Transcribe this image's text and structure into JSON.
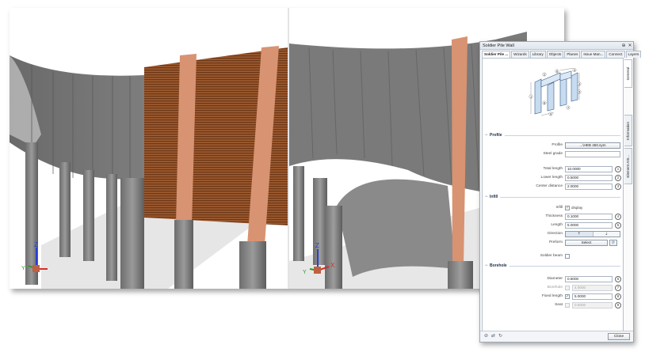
{
  "dialog": {
    "title": "Soldier Pile Wall",
    "pin_glyph": "⊕",
    "close_glyph": "✕",
    "tabs": [
      {
        "label": "Soldier Pile ..."
      },
      {
        "label": "Wizards"
      },
      {
        "label": "Library"
      },
      {
        "label": "Objects"
      },
      {
        "label": "Planes"
      },
      {
        "label": "Issue Man..."
      },
      {
        "label": "Connect"
      },
      {
        "label": "Layers"
      }
    ],
    "side_tabs": [
      {
        "label": "General"
      },
      {
        "label": "Information"
      },
      {
        "label": "Element Attr..."
      }
    ],
    "preview_labels": [
      "1",
      "2",
      "3",
      "4",
      "5",
      "6",
      "7",
      "8",
      "9"
    ],
    "sections": {
      "profile": {
        "title": "Profile",
        "profile_label": "Profile",
        "profile_value": "...\\HEB 450.sym",
        "steel_grade_label": "Steel grade",
        "steel_grade_value": "",
        "total_length_label": "Total length",
        "total_length_value": "10.0000",
        "lower_length_label": "Lower length",
        "lower_length_value": "0.5000",
        "center_distance_label": "Center distance",
        "center_distance_value": "2.0000"
      },
      "infill": {
        "title": "Infill",
        "infill_label": "Infill",
        "display_text": "display",
        "thickness_label": "Thickness",
        "thickness_value": "0.1000",
        "length_label": "Length",
        "length_value": "5.0000",
        "direction_label": "Direction",
        "direction_up": "⇡",
        "direction_down": "⇣",
        "preform_label": "Preform",
        "select_label": "Select",
        "soldier_beam_label": "Soldier beam"
      },
      "borehole": {
        "title": "Borehole",
        "diameter_label": "Diameter",
        "diameter_value": "0.6000",
        "borehole_label": "Borehole",
        "borehole_value": "4.0000",
        "fixed_length_label": "Fixed length",
        "fixed_length_value": "5.0000",
        "seat_label": "Seat",
        "seat_value": "0.5000"
      }
    },
    "markers": [
      "1",
      "2",
      "3",
      "4",
      "5",
      "6",
      "7",
      "8",
      "9"
    ],
    "minus_glyph": "−",
    "check_glyph": "✓",
    "link_glyph": "⟳",
    "footer": {
      "icon_a": "⊘",
      "icon_b": "⇄",
      "icon_c": "↻",
      "close_label": "Close"
    }
  },
  "axes": {
    "x": "X",
    "y": "Y",
    "z": "Z"
  },
  "colors": {
    "concrete": "#8a8a8a",
    "timber": "#8b4a22",
    "beam": "#d38a68",
    "axis_x": "#d0302a",
    "axis_y": "#2a9a2a",
    "axis_z": "#2a3fd0"
  }
}
